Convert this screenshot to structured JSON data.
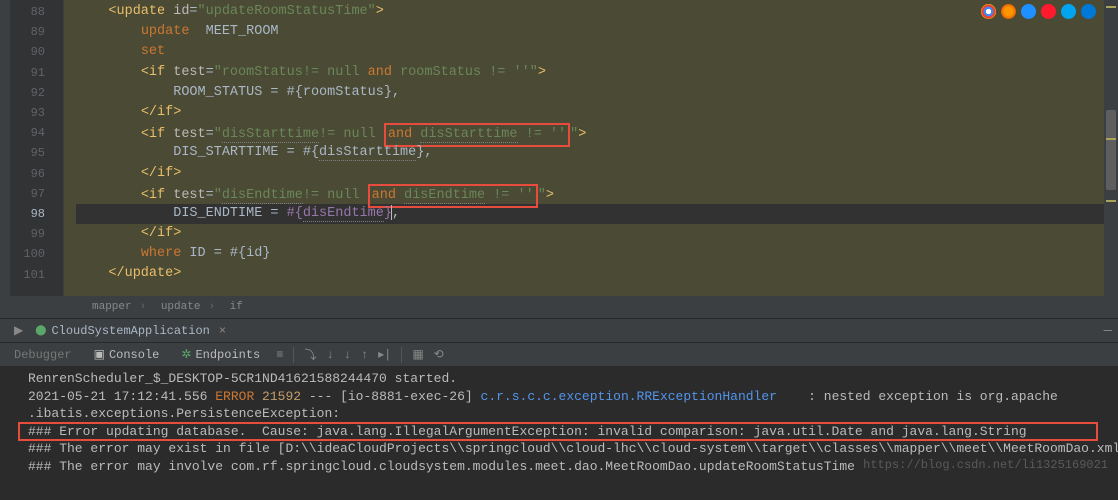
{
  "gutter": {
    "start": 88,
    "end": 101,
    "current": 98
  },
  "code": {
    "l88": {
      "tag_open": "<update ",
      "attr": "id",
      "val": "\"updateRoomStatusTime\"",
      "end": ">"
    },
    "l89": {
      "kw1": "update",
      "txt": "  MEET_ROOM"
    },
    "l90": {
      "kw1": "set"
    },
    "l91": {
      "tag_open": "<if ",
      "attr": "test",
      "val_pre": "\"roomStatus!= null ",
      "val_kw": "and",
      "val_post": " roomStatus != ''\"",
      "end": ">"
    },
    "l92": {
      "txt": "ROOM_STATUS = #{roomStatus},"
    },
    "l93": {
      "tag_close": "</if>"
    },
    "l94": {
      "tag_open": "<if ",
      "attr": "test",
      "val_pre": "\"",
      "u1": "disStarttime",
      "val_mid": "!= null ",
      "val_kw": "and",
      "box_pre": " ",
      "u2": "disStarttime",
      "box_post": " != ''",
      "val_end": "\"",
      "end": ">"
    },
    "l95": {
      "txt1": "DIS_STARTTIME = #{",
      "u": "disStarttime",
      "txt2": "},"
    },
    "l96": {
      "tag_close": "</if>"
    },
    "l97": {
      "tag_open": "<if ",
      "attr": "test",
      "val_pre": "\"",
      "u1": "disEndtime",
      "val_mid": "!= null ",
      "val_kw": "and",
      "box_pre": " ",
      "u2": "disEndtime",
      "box_post": " != ''",
      "val_end": "\"",
      "end": ">"
    },
    "l98": {
      "txt1": "DIS_ENDTIME = ",
      "p1": "#{",
      "u": "disEndtime",
      "p2": "}",
      "comma": ","
    },
    "l99": {
      "tag_close": "</if>"
    },
    "l100": {
      "kw1": "where",
      "txt": " ID = #{id}"
    },
    "l101": {
      "tag_close": "</update>"
    }
  },
  "breadcrumb": {
    "a": "mapper",
    "b": "update",
    "c": "if"
  },
  "run": {
    "tab": "CloudSystemApplication"
  },
  "toolbar": {
    "debugger": "Debugger",
    "console": "Console",
    "endpoints": "Endpoints"
  },
  "console": {
    "l1": "RenrenScheduler_$_DESKTOP-5CR1ND41621588244470 started.",
    "l2_time": "2021-05-21 17:12:41.556 ",
    "l2_level": "ERROR",
    "l2_pid": " 21592",
    "l2_dash": " --- [",
    "l2_thread": "io-8881-exec-26",
    "l2_br": "] ",
    "l2_class": "c.r.s.c.c.exception.RRExceptionHandler",
    "l2_msg": "    : nested exception is org.apache",
    "l3": ".ibatis.exceptions.PersistenceException:",
    "l4": "### Error updating database.  Cause: java.lang.IllegalArgumentException: invalid comparison: java.util.Date and java.lang.String",
    "l5": "### The error may exist in file [D:\\\\ideaCloudProjects\\\\springcloud\\\\cloud-lhc\\\\cloud-system\\\\target\\\\classes\\\\mapper\\\\meet\\\\MeetRoomDao.xml]",
    "l6": "### The error may involve com.rf.springcloud.cloudsystem.modules.meet.dao.MeetRoomDao.updateRoomStatusTime"
  },
  "watermark": "https://blog.csdn.net/li1325169021"
}
